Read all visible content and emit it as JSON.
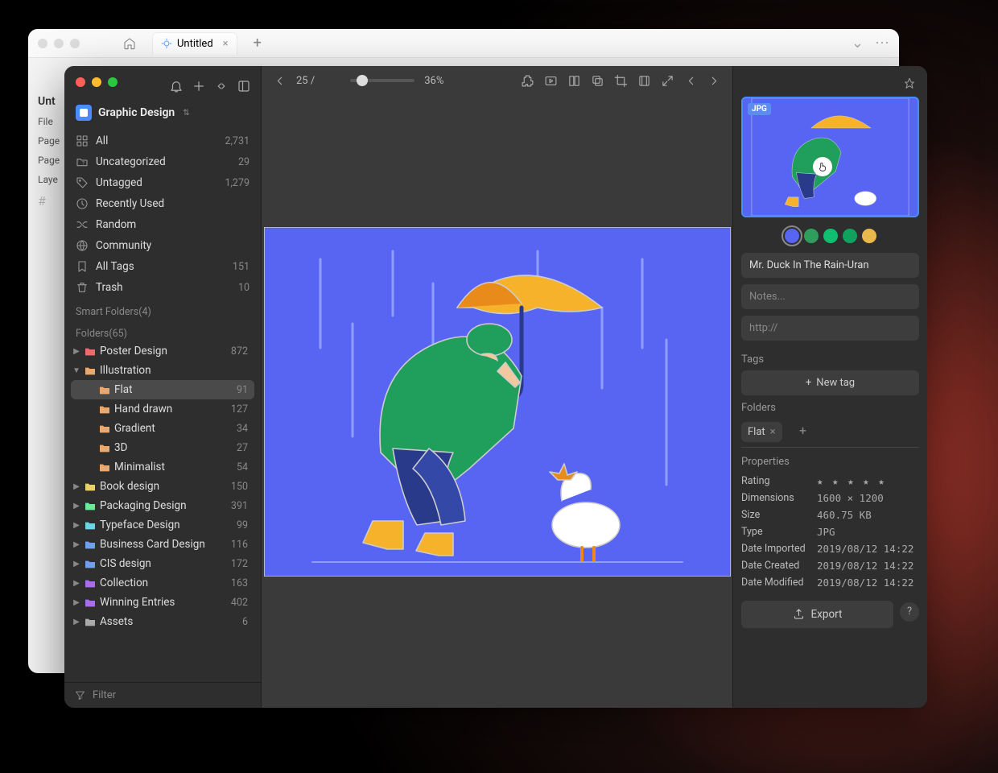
{
  "bgWindow": {
    "tabTitle": "Untitled",
    "leftColLabels": [
      "Unt",
      "File",
      "Page",
      "Page",
      "Laye"
    ]
  },
  "sidebar": {
    "libraryName": "Graphic Design",
    "fixed": [
      {
        "icon": "grid",
        "label": "All",
        "count": "2,731"
      },
      {
        "icon": "folder-q",
        "label": "Uncategorized",
        "count": "29"
      },
      {
        "icon": "tag-q",
        "label": "Untagged",
        "count": "1,279"
      },
      {
        "icon": "clock",
        "label": "Recently Used",
        "count": ""
      },
      {
        "icon": "shuffle",
        "label": "Random",
        "count": ""
      },
      {
        "icon": "globe",
        "label": "Community",
        "count": ""
      },
      {
        "icon": "bookmark",
        "label": "All Tags",
        "count": "151"
      },
      {
        "icon": "trash",
        "label": "Trash",
        "count": "10"
      }
    ],
    "smartFoldersLabel": "Smart Folders(4)",
    "foldersLabel": "Folders(65)",
    "folders": [
      {
        "toggle": "▶",
        "color": "fc-red",
        "label": "Poster Design",
        "count": "872",
        "selected": false
      },
      {
        "toggle": "▼",
        "color": "fc-orange",
        "label": "Illustration",
        "count": "",
        "selected": false,
        "children": [
          {
            "color": "fc-orange",
            "label": "Flat",
            "count": "91",
            "selected": true
          },
          {
            "color": "fc-orange",
            "label": "Hand drawn",
            "count": "127",
            "selected": false
          },
          {
            "color": "fc-orange",
            "label": "Gradient",
            "count": "34",
            "selected": false
          },
          {
            "color": "fc-orange",
            "label": "3D",
            "count": "27",
            "selected": false
          },
          {
            "color": "fc-orange",
            "label": "Minimalist",
            "count": "54",
            "selected": false
          }
        ]
      },
      {
        "toggle": "▶",
        "color": "fc-yellow",
        "label": "Book design",
        "count": "150"
      },
      {
        "toggle": "▶",
        "color": "fc-green",
        "label": "Packaging Design",
        "count": "391"
      },
      {
        "toggle": "▶",
        "color": "fc-teal",
        "label": "Typeface Design",
        "count": "99"
      },
      {
        "toggle": "▶",
        "color": "fc-blue",
        "label": "Business Card Design",
        "count": "116"
      },
      {
        "toggle": "▶",
        "color": "fc-blue",
        "label": "CIS design",
        "count": "172"
      },
      {
        "toggle": "▶",
        "color": "fc-purple",
        "label": "Collection",
        "count": "163"
      },
      {
        "toggle": "▶",
        "color": "fc-purple",
        "label": "Winning Entries",
        "count": "402"
      },
      {
        "toggle": "▶",
        "color": "fc-grey",
        "label": "Assets",
        "count": "6"
      }
    ],
    "filterPlaceholder": "Filter"
  },
  "toolbar": {
    "pageText": "25 /",
    "zoom": "36%"
  },
  "inspector": {
    "badge": "JPG",
    "colors": [
      "#5865f2",
      "#2f9e5c",
      "#0fbf6f",
      "#10a35f",
      "#e9b94d"
    ],
    "title": "Mr. Duck In The Rain-Uran",
    "notesPlaceholder": "Notes...",
    "urlPlaceholder": "http://",
    "tagsLabel": "Tags",
    "newTag": "New tag",
    "foldersLabel": "Folders",
    "folderChip": "Flat",
    "propsLabel": "Properties",
    "props": [
      {
        "k": "Rating",
        "v": "★ ★ ★ ★ ★"
      },
      {
        "k": "Dimensions",
        "v": "1600 × 1200"
      },
      {
        "k": "Size",
        "v": "460.75 KB"
      },
      {
        "k": "Type",
        "v": "JPG"
      },
      {
        "k": "Date Imported",
        "v": "2019/08/12 14:22"
      },
      {
        "k": "Date Created",
        "v": "2019/08/12 14:22"
      },
      {
        "k": "Date Modified",
        "v": "2019/08/12 14:22"
      }
    ],
    "export": "Export"
  }
}
